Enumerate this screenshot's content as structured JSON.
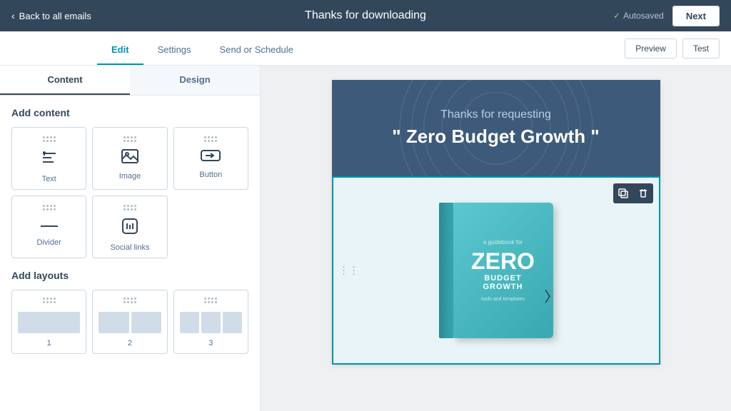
{
  "topNav": {
    "backLabel": "Back to all emails",
    "title": "Thanks for downloading",
    "autosaved": "Autosaved",
    "nextLabel": "Next"
  },
  "tabBar": {
    "tabs": [
      {
        "id": "edit",
        "label": "Edit",
        "active": true
      },
      {
        "id": "settings",
        "label": "Settings",
        "active": false
      },
      {
        "id": "send-or-schedule",
        "label": "Send or Schedule",
        "active": false
      }
    ],
    "actions": [
      {
        "id": "preview",
        "label": "Preview"
      },
      {
        "id": "test",
        "label": "Test"
      }
    ]
  },
  "leftPanel": {
    "tabs": [
      {
        "id": "content",
        "label": "Content",
        "active": true
      },
      {
        "id": "design",
        "label": "Design",
        "active": false
      }
    ],
    "addContent": {
      "title": "Add content",
      "items": [
        {
          "id": "text",
          "label": "Text",
          "icon": "text"
        },
        {
          "id": "image",
          "label": "Image",
          "icon": "image"
        },
        {
          "id": "button",
          "label": "Button",
          "icon": "button"
        },
        {
          "id": "divider",
          "label": "Divider",
          "icon": "divider"
        },
        {
          "id": "social-links",
          "label": "Social links",
          "icon": "hash"
        }
      ]
    },
    "addLayouts": {
      "title": "Add layouts",
      "items": [
        {
          "id": "layout-1",
          "label": "1",
          "cols": 1
        },
        {
          "id": "layout-2",
          "label": "2",
          "cols": 2
        },
        {
          "id": "layout-3",
          "label": "3",
          "cols": 3
        }
      ]
    }
  },
  "emailPreview": {
    "hero": {
      "subtext": "Thanks for requesting",
      "maintext": "\" Zero Budget Growth \""
    },
    "bookSection": {
      "guidebookLabel": "a guidebook for",
      "zeroLabel": "ZERO",
      "budgetLabel": "BUDGET GROWTH",
      "toolsLabel": "tools and templates"
    },
    "toolbar": {
      "copyLabel": "⧉",
      "deleteLabel": "🗑"
    }
  },
  "colors": {
    "navBg": "#33475b",
    "heroBg": "#3d5a7a",
    "bookBg": "#e8f4f8",
    "bookCover": "#4bbfc8",
    "accent": "#0091ae"
  }
}
